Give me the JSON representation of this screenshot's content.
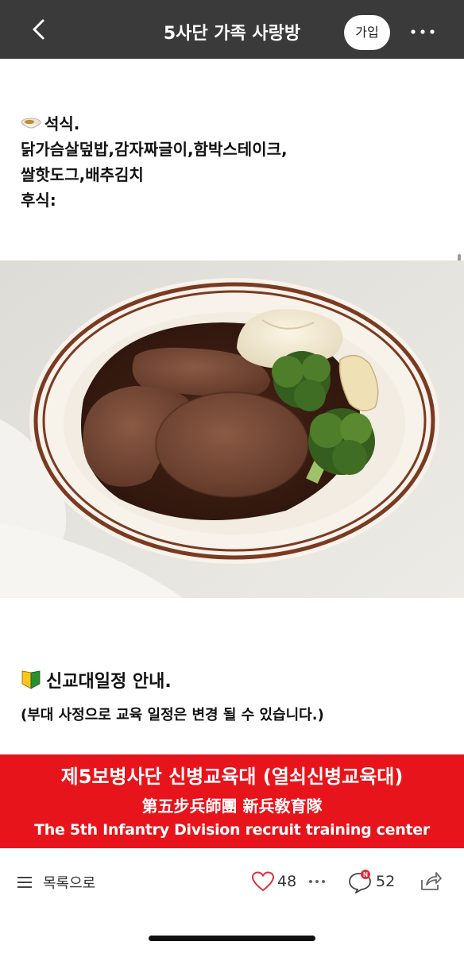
{
  "header": {
    "title": "5사단 가족 사랑방",
    "join_label": "가입"
  },
  "post": {
    "meal": {
      "heading": "석식.",
      "menu_line1": "닭가슴살덮밥,감자짜글이,함박스테이크,",
      "menu_line2": "쌀핫도그,배추김치",
      "snack": "후식:"
    },
    "schedule": {
      "heading": "신교대일정 안내.",
      "note": "(부대 사정으로 교육 일정은 변경 될 수 있습니다.)"
    },
    "banner": {
      "line1": "제5보병사단 신병교육대 (열쇠신병교육대)",
      "line2": "第五步兵師團 新兵敎育隊",
      "line3": "The 5th Infantry Division recruit training center"
    }
  },
  "footer": {
    "list_label": "목록으로",
    "like_count": "48",
    "comment_count": "52",
    "comment_badge": "N"
  },
  "colors": {
    "header_bg": "#3a3a3a",
    "banner_red": "#e8141b",
    "like_heart": "#e02b3a",
    "badge": "#e02b3a"
  }
}
